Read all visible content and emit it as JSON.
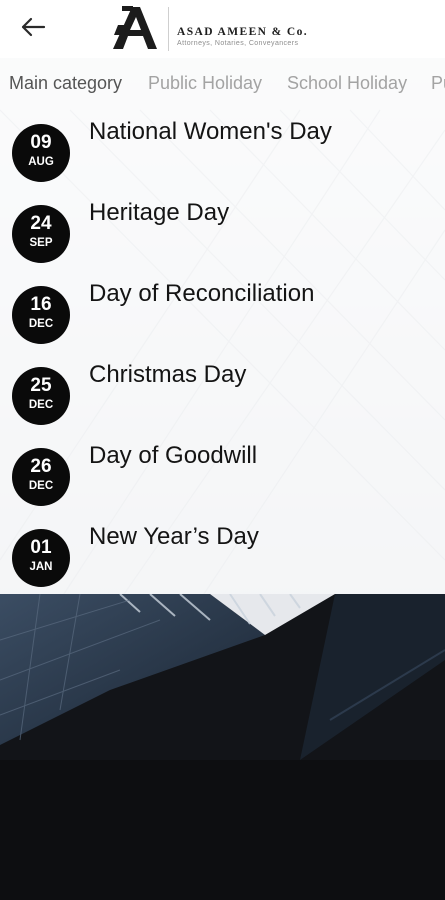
{
  "header": {
    "back_icon": "arrow-left-icon",
    "logo_name": "ASAD AMEEN & Co.",
    "logo_tagline": "Attorneys, Notaries, Conveyancers"
  },
  "tabs": [
    {
      "label": "Main category",
      "active": true
    },
    {
      "label": "Public Holiday",
      "active": false
    },
    {
      "label": "School Holiday",
      "active": false
    },
    {
      "label": "Pu",
      "active": false
    }
  ],
  "holidays": [
    {
      "day": "09",
      "month": "AUG",
      "name": "National Women's Day"
    },
    {
      "day": "24",
      "month": "SEP",
      "name": "Heritage Day"
    },
    {
      "day": "16",
      "month": "DEC",
      "name": "Day of Reconciliation"
    },
    {
      "day": "25",
      "month": "DEC",
      "name": "Christmas Day"
    },
    {
      "day": "26",
      "month": "DEC",
      "name": "Day of Goodwill"
    },
    {
      "day": "01",
      "month": "JAN",
      "name": "New Year’s Day"
    }
  ],
  "colors": {
    "badge": "#0a0a0a",
    "tab_active": "#555555",
    "tab_inactive": "#a3a3a3",
    "background_dark": "#0e0f12"
  }
}
